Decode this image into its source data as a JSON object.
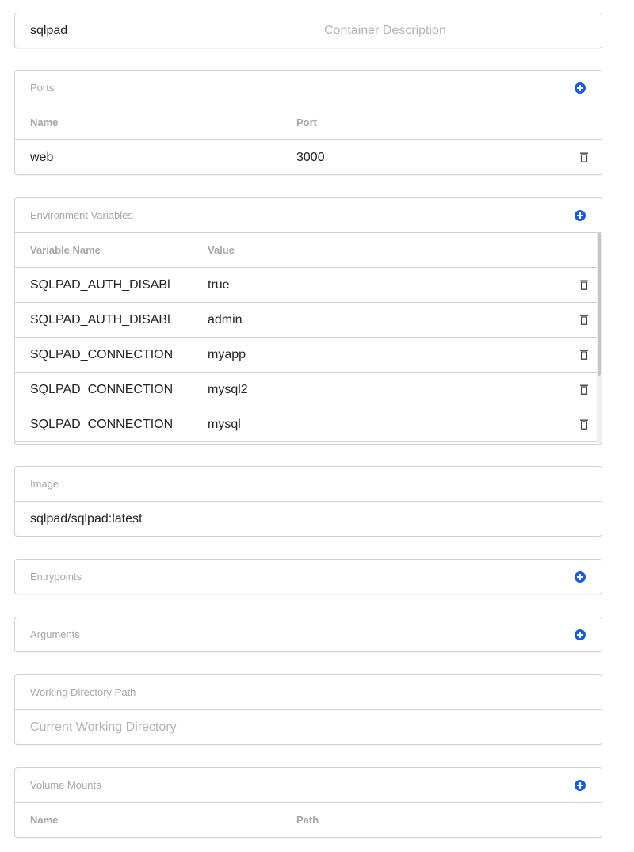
{
  "container": {
    "name_value": "sqlpad",
    "description_placeholder": "Container Description"
  },
  "ports": {
    "title": "Ports",
    "headers": {
      "name": "Name",
      "port": "Port"
    },
    "rows": [
      {
        "name": "web",
        "port": "3000"
      }
    ]
  },
  "env": {
    "title": "Environment Variables",
    "headers": {
      "name": "Variable Name",
      "value": "Value"
    },
    "rows": [
      {
        "name": "SQLPAD_AUTH_DISABl",
        "value": "true"
      },
      {
        "name": "SQLPAD_AUTH_DISABl",
        "value": "admin"
      },
      {
        "name": "SQLPAD_CONNECTION",
        "value": "myapp"
      },
      {
        "name": "SQLPAD_CONNECTION",
        "value": "mysql2"
      },
      {
        "name": "SQLPAD_CONNECTION",
        "value": "mysql"
      }
    ]
  },
  "image": {
    "title": "Image",
    "value": "sqlpad/sqlpad:latest"
  },
  "entrypoints": {
    "title": "Entrypoints"
  },
  "arguments": {
    "title": "Arguments"
  },
  "working_dir": {
    "title": "Working Directory Path",
    "placeholder": "Current Working Directory"
  },
  "volumes": {
    "title": "Volume Mounts",
    "headers": {
      "name": "Name",
      "path": "Path"
    }
  },
  "icons": {
    "add": "plus-circle-icon",
    "delete": "trash-icon"
  },
  "colors": {
    "accent": "#1a5cd6",
    "border": "#d2d2d2",
    "muted_text": "#a7a7a7"
  }
}
